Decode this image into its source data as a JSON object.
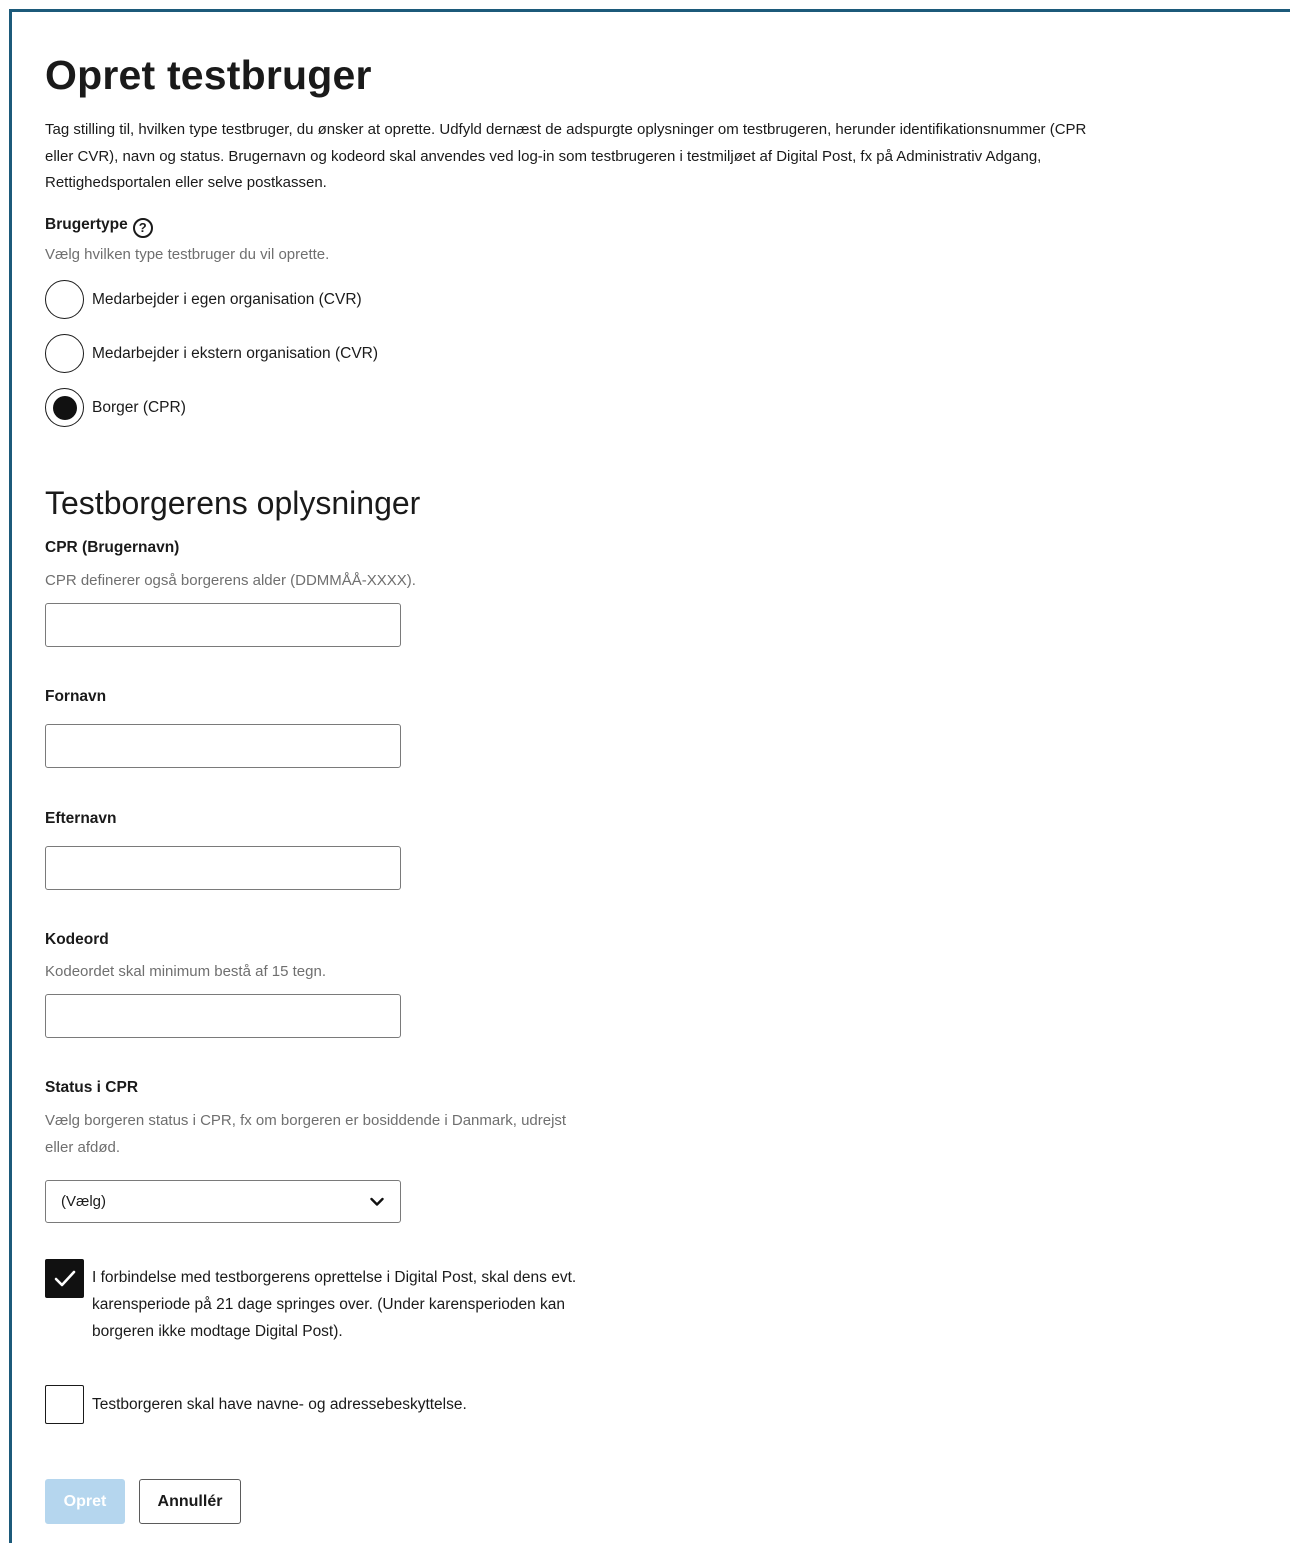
{
  "page": {
    "title": "Opret testbruger",
    "intro_line1": "Tag stilling til, hvilken type testbruger, du ønsker at oprette. Udfyld dernæst de adspurgte oplysninger om testbrugeren, herunder identifikationsnummer (CPR",
    "intro_line2": "eller CVR), navn og status. Brugernavn og kodeord skal anvendes ved log-in som testbrugeren i testmiljøet af Digital Post, fx på Administrativ Adgang,",
    "intro_line3": "Rettighedsportalen eller selve postkassen."
  },
  "user_type": {
    "label": "Brugertype",
    "help_icon": "?",
    "help_text": "Vælg hvilken type testbruger du vil oprette.",
    "options": [
      {
        "label": "Medarbejder i egen organisation (CVR)",
        "selected": false
      },
      {
        "label": "Medarbejder i ekstern organisation (CVR)",
        "selected": false
      },
      {
        "label": "Borger (CPR)",
        "selected": true
      }
    ]
  },
  "section": {
    "title": "Testborgerens oplysninger"
  },
  "cpr": {
    "label": "CPR (Brugernavn)",
    "help": "CPR definerer også borgerens alder (DDMMÅÅ-XXXX).",
    "value": ""
  },
  "first_name": {
    "label": "Fornavn",
    "value": ""
  },
  "last_name": {
    "label": "Efternavn",
    "value": ""
  },
  "password": {
    "label": "Kodeord",
    "help": "Kodeordet skal minimum bestå af 15 tegn.",
    "value": ""
  },
  "status": {
    "label": "Status i CPR",
    "help_line1": "Vælg borgeren status i CPR, fx om borgeren er bosiddende i Danmark, udrejst",
    "help_line2": "eller afdød.",
    "selected": "(Vælg)"
  },
  "checkboxes": {
    "skip_grace": {
      "checked": true,
      "line1": "I forbindelse med testborgerens oprettelse i Digital Post, skal dens evt.",
      "line2": "karensperiode på 21 dage springes over. (Under karensperioden kan",
      "line3": "borgeren ikke modtage Digital Post)."
    },
    "protection": {
      "checked": false,
      "label": "Testborgeren skal have navne- og adressebeskyttelse."
    }
  },
  "buttons": {
    "create": "Opret",
    "cancel": "Annullér"
  },
  "colors": {
    "frame_border": "#1c5a7a",
    "primary_disabled": "#b5d6ee",
    "help_text": "#6f6f6f"
  }
}
